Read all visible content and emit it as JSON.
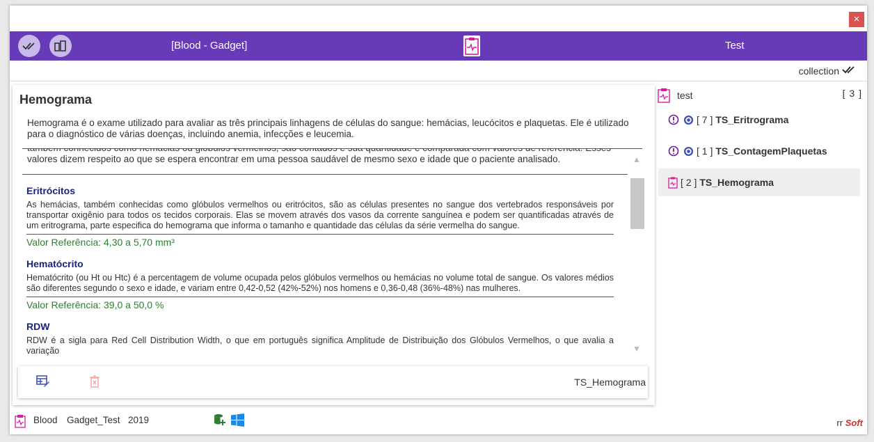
{
  "window": {
    "close_label": "×"
  },
  "header": {
    "title": "[Blood - Gadget]",
    "right_label": "Test"
  },
  "collection_bar": {
    "label": "collection"
  },
  "card": {
    "title": "Hemograma",
    "description": "Hemograma é o exame utilizado para avaliar as três principais linhagens de células do sangue: hemácias, leucócitos e plaquetas. Ele é utilizado para o diagnóstico de várias doenças, incluindo anemia, infecções e leucemia.",
    "intro_text": "também conhecidos como hemácias ou glóbulos vermelhos, são contados e sua quantidade é comparada com valores de referência. Esses valores dizem respeito ao que se espera encontrar em uma pessoa saudável de mesmo sexo e idade que o paciente analisado.",
    "sections": [
      {
        "title": "Eritrócitos",
        "text": "As hemácias, também conhecidas como glóbulos vermelhos ou eritrócitos, são as células presentes no sangue dos vertebrados responsáveis por transportar oxigênio para todos os tecidos corporais. Elas se movem através dos vasos da corrente sanguínea e podem ser quantificadas através de um eritrograma, parte especifica do hemograma que informa o tamanho e quantidade das células da série vermelha do sangue.",
        "reference": "Valor Referência: 4,30 a 5,70 mm³"
      },
      {
        "title": "Hematócrito",
        "text": "Hematócrito (ou Ht ou Htc) é a percentagem de volume ocupada pelos glóbulos vermelhos ou hemácias no volume total de sangue. Os valores médios são diferentes segundo o sexo e idade, e variam entre 0,42-0,52 (42%-52%) nos homens e 0,36-0,48 (36%-48%) nas mulheres.",
        "reference": "Valor Referência: 39,0 a 50,0 %"
      },
      {
        "title": "RDW",
        "text": "RDW é a sigla para Red Cell Distribution Width, o que em português significa Amplitude de Distribuição dos Glóbulos Vermelhos, o que avalia a variação"
      }
    ],
    "footer_name": "TS_Hemograma"
  },
  "right_panel": {
    "label": "test",
    "count": "[ 3 ]",
    "items": [
      {
        "num": "[ 7 ]",
        "name": "TS_Eritrograma"
      },
      {
        "num": "[ 1 ]",
        "name": "TS_ContagemPlaquetas"
      },
      {
        "num": "[ 2 ]",
        "name": "TS_Hemograma"
      }
    ]
  },
  "status": {
    "category": "Blood",
    "project": "Gadget_Test",
    "year": "2019",
    "brand_prefix": "rr",
    "brand_name": "Soft"
  },
  "colors": {
    "accent": "#673ab7",
    "close": "#d9534f",
    "link_title": "#1a237e",
    "reference": "#2e7d32",
    "brand": "#d32f2f",
    "magenta_icon": "#d81b9b"
  }
}
